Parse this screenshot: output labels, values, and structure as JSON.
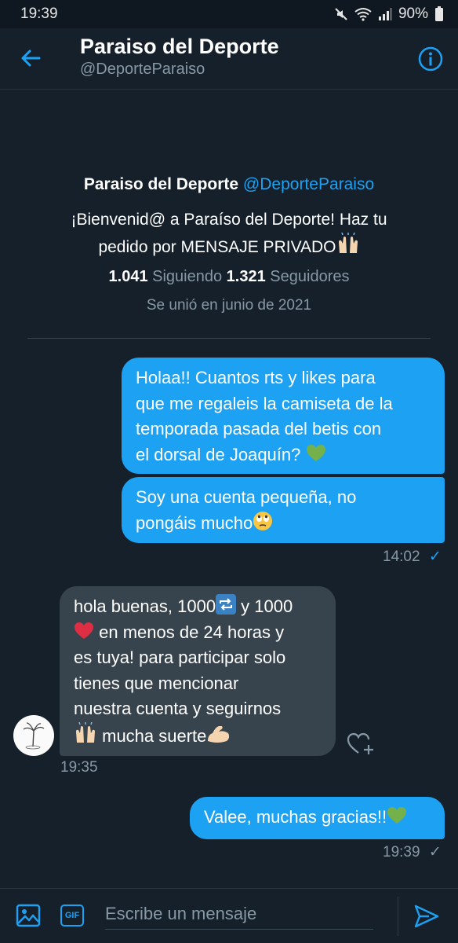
{
  "status_bar": {
    "time": "19:39",
    "battery": "90%"
  },
  "header": {
    "title": "Paraiso del Deporte",
    "handle": "@DeporteParaiso"
  },
  "profile": {
    "name": "Paraiso del Deporte",
    "handle": "@DeporteParaiso",
    "bio_line1": "¡Bienvenid@ a Paraíso del Deporte! Haz tu",
    "bio_line2": "pedido por MENSAJE PRIVADO",
    "following_count": "1.041",
    "following_label": "Siguiendo",
    "followers_count": "1.321",
    "followers_label": "Seguidores",
    "joined": "Se unió en junio de 2021"
  },
  "messages": {
    "m1_lines": [
      "Holaa!! Cuantos rts y likes para",
      "que me regaleis la camiseta de la",
      "temporada pasada del betis con",
      "el dorsal de Joaquín? "
    ],
    "m2_lines": [
      "Soy una cuenta pequeña, no",
      "pongáis mucho"
    ],
    "m2_time": "14:02",
    "m3_lines": [
      "hola buenas, 1000",
      " y 1000",
      " en menos de 24 horas y",
      "es tuya! para participar solo",
      "tienes que mencionar",
      "nuestra cuenta y seguirnos",
      " mucha suerte"
    ],
    "m3_time": "19:35",
    "m4_text": "Valee, muchas gracias!!",
    "m4_time": "19:39"
  },
  "composer": {
    "gif_label": "GIF",
    "placeholder": "Escribe un mensaje"
  },
  "colors": {
    "background": "#15202b",
    "accent": "#1da1f2",
    "incoming_bubble": "#38444d",
    "muted_text": "#8899a6"
  },
  "icons": [
    "back-arrow-icon",
    "info-icon",
    "raising-hands-icon",
    "green-heart-icon",
    "rolling-eyes-icon",
    "repeat-icon",
    "red-heart-icon",
    "flexed-biceps-icon",
    "heart-plus-icon",
    "image-icon",
    "send-icon",
    "check-icon"
  ]
}
